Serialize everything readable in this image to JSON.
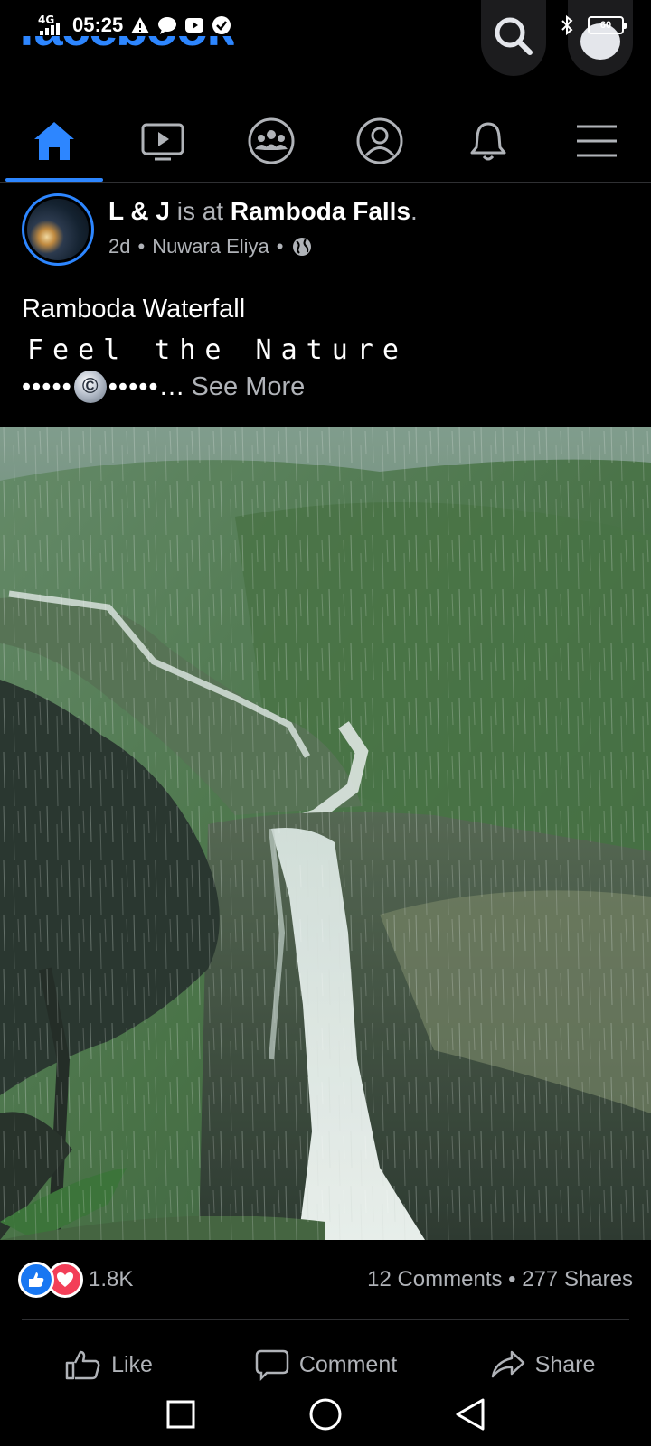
{
  "status_bar": {
    "network": "4G",
    "time": "05:25",
    "battery": "60",
    "icons": [
      "warning-icon",
      "chat-bubble-icon",
      "youtube-icon",
      "check-badge-icon",
      "bluetooth-icon"
    ]
  },
  "header": {
    "logo": "facebook"
  },
  "tabs": [
    {
      "name": "home",
      "icon": "home-icon",
      "active": true
    },
    {
      "name": "watch",
      "icon": "video-icon",
      "active": false
    },
    {
      "name": "groups",
      "icon": "groups-icon",
      "active": false
    },
    {
      "name": "profile",
      "icon": "profile-icon",
      "active": false
    },
    {
      "name": "notifications",
      "icon": "bell-icon",
      "active": false
    },
    {
      "name": "menu",
      "icon": "menu-icon",
      "active": false
    }
  ],
  "post": {
    "author": "L & J",
    "connector": " is at ",
    "location": "Ramboda Falls",
    "period": ".",
    "age": "2d",
    "place": "Nuwara Eliya",
    "sep": "•",
    "title": "Ramboda Waterfall",
    "subtitle": "Feel the Nature",
    "dots_left": "•••••",
    "copyright_symbol": "©",
    "dots_right": "•••••…",
    "see_more": "See More"
  },
  "reactions": {
    "count": "1.8K",
    "comments": "12 Comments",
    "dot": "•",
    "shares": "277 Shares"
  },
  "actions": {
    "like": "Like",
    "comment": "Comment",
    "share": "Share"
  },
  "colors": {
    "accent": "#2d86ff",
    "background": "#000000",
    "muted_text": "#b0b3b8"
  }
}
